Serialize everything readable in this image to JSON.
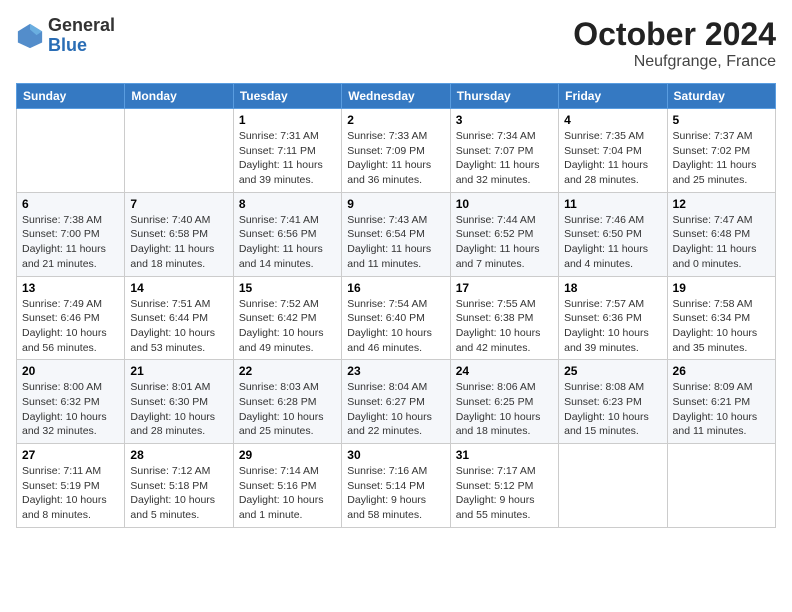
{
  "header": {
    "logo_general": "General",
    "logo_blue": "Blue",
    "month": "October 2024",
    "location": "Neufgrange, France"
  },
  "weekdays": [
    "Sunday",
    "Monday",
    "Tuesday",
    "Wednesday",
    "Thursday",
    "Friday",
    "Saturday"
  ],
  "weeks": [
    [
      {
        "day": "",
        "sunrise": "",
        "sunset": "",
        "daylight": ""
      },
      {
        "day": "",
        "sunrise": "",
        "sunset": "",
        "daylight": ""
      },
      {
        "day": "1",
        "sunrise": "Sunrise: 7:31 AM",
        "sunset": "Sunset: 7:11 PM",
        "daylight": "Daylight: 11 hours and 39 minutes."
      },
      {
        "day": "2",
        "sunrise": "Sunrise: 7:33 AM",
        "sunset": "Sunset: 7:09 PM",
        "daylight": "Daylight: 11 hours and 36 minutes."
      },
      {
        "day": "3",
        "sunrise": "Sunrise: 7:34 AM",
        "sunset": "Sunset: 7:07 PM",
        "daylight": "Daylight: 11 hours and 32 minutes."
      },
      {
        "day": "4",
        "sunrise": "Sunrise: 7:35 AM",
        "sunset": "Sunset: 7:04 PM",
        "daylight": "Daylight: 11 hours and 28 minutes."
      },
      {
        "day": "5",
        "sunrise": "Sunrise: 7:37 AM",
        "sunset": "Sunset: 7:02 PM",
        "daylight": "Daylight: 11 hours and 25 minutes."
      }
    ],
    [
      {
        "day": "6",
        "sunrise": "Sunrise: 7:38 AM",
        "sunset": "Sunset: 7:00 PM",
        "daylight": "Daylight: 11 hours and 21 minutes."
      },
      {
        "day": "7",
        "sunrise": "Sunrise: 7:40 AM",
        "sunset": "Sunset: 6:58 PM",
        "daylight": "Daylight: 11 hours and 18 minutes."
      },
      {
        "day": "8",
        "sunrise": "Sunrise: 7:41 AM",
        "sunset": "Sunset: 6:56 PM",
        "daylight": "Daylight: 11 hours and 14 minutes."
      },
      {
        "day": "9",
        "sunrise": "Sunrise: 7:43 AM",
        "sunset": "Sunset: 6:54 PM",
        "daylight": "Daylight: 11 hours and 11 minutes."
      },
      {
        "day": "10",
        "sunrise": "Sunrise: 7:44 AM",
        "sunset": "Sunset: 6:52 PM",
        "daylight": "Daylight: 11 hours and 7 minutes."
      },
      {
        "day": "11",
        "sunrise": "Sunrise: 7:46 AM",
        "sunset": "Sunset: 6:50 PM",
        "daylight": "Daylight: 11 hours and 4 minutes."
      },
      {
        "day": "12",
        "sunrise": "Sunrise: 7:47 AM",
        "sunset": "Sunset: 6:48 PM",
        "daylight": "Daylight: 11 hours and 0 minutes."
      }
    ],
    [
      {
        "day": "13",
        "sunrise": "Sunrise: 7:49 AM",
        "sunset": "Sunset: 6:46 PM",
        "daylight": "Daylight: 10 hours and 56 minutes."
      },
      {
        "day": "14",
        "sunrise": "Sunrise: 7:51 AM",
        "sunset": "Sunset: 6:44 PM",
        "daylight": "Daylight: 10 hours and 53 minutes."
      },
      {
        "day": "15",
        "sunrise": "Sunrise: 7:52 AM",
        "sunset": "Sunset: 6:42 PM",
        "daylight": "Daylight: 10 hours and 49 minutes."
      },
      {
        "day": "16",
        "sunrise": "Sunrise: 7:54 AM",
        "sunset": "Sunset: 6:40 PM",
        "daylight": "Daylight: 10 hours and 46 minutes."
      },
      {
        "day": "17",
        "sunrise": "Sunrise: 7:55 AM",
        "sunset": "Sunset: 6:38 PM",
        "daylight": "Daylight: 10 hours and 42 minutes."
      },
      {
        "day": "18",
        "sunrise": "Sunrise: 7:57 AM",
        "sunset": "Sunset: 6:36 PM",
        "daylight": "Daylight: 10 hours and 39 minutes."
      },
      {
        "day": "19",
        "sunrise": "Sunrise: 7:58 AM",
        "sunset": "Sunset: 6:34 PM",
        "daylight": "Daylight: 10 hours and 35 minutes."
      }
    ],
    [
      {
        "day": "20",
        "sunrise": "Sunrise: 8:00 AM",
        "sunset": "Sunset: 6:32 PM",
        "daylight": "Daylight: 10 hours and 32 minutes."
      },
      {
        "day": "21",
        "sunrise": "Sunrise: 8:01 AM",
        "sunset": "Sunset: 6:30 PM",
        "daylight": "Daylight: 10 hours and 28 minutes."
      },
      {
        "day": "22",
        "sunrise": "Sunrise: 8:03 AM",
        "sunset": "Sunset: 6:28 PM",
        "daylight": "Daylight: 10 hours and 25 minutes."
      },
      {
        "day": "23",
        "sunrise": "Sunrise: 8:04 AM",
        "sunset": "Sunset: 6:27 PM",
        "daylight": "Daylight: 10 hours and 22 minutes."
      },
      {
        "day": "24",
        "sunrise": "Sunrise: 8:06 AM",
        "sunset": "Sunset: 6:25 PM",
        "daylight": "Daylight: 10 hours and 18 minutes."
      },
      {
        "day": "25",
        "sunrise": "Sunrise: 8:08 AM",
        "sunset": "Sunset: 6:23 PM",
        "daylight": "Daylight: 10 hours and 15 minutes."
      },
      {
        "day": "26",
        "sunrise": "Sunrise: 8:09 AM",
        "sunset": "Sunset: 6:21 PM",
        "daylight": "Daylight: 10 hours and 11 minutes."
      }
    ],
    [
      {
        "day": "27",
        "sunrise": "Sunrise: 7:11 AM",
        "sunset": "Sunset: 5:19 PM",
        "daylight": "Daylight: 10 hours and 8 minutes."
      },
      {
        "day": "28",
        "sunrise": "Sunrise: 7:12 AM",
        "sunset": "Sunset: 5:18 PM",
        "daylight": "Daylight: 10 hours and 5 minutes."
      },
      {
        "day": "29",
        "sunrise": "Sunrise: 7:14 AM",
        "sunset": "Sunset: 5:16 PM",
        "daylight": "Daylight: 10 hours and 1 minute."
      },
      {
        "day": "30",
        "sunrise": "Sunrise: 7:16 AM",
        "sunset": "Sunset: 5:14 PM",
        "daylight": "Daylight: 9 hours and 58 minutes."
      },
      {
        "day": "31",
        "sunrise": "Sunrise: 7:17 AM",
        "sunset": "Sunset: 5:12 PM",
        "daylight": "Daylight: 9 hours and 55 minutes."
      },
      {
        "day": "",
        "sunrise": "",
        "sunset": "",
        "daylight": ""
      },
      {
        "day": "",
        "sunrise": "",
        "sunset": "",
        "daylight": ""
      }
    ]
  ]
}
